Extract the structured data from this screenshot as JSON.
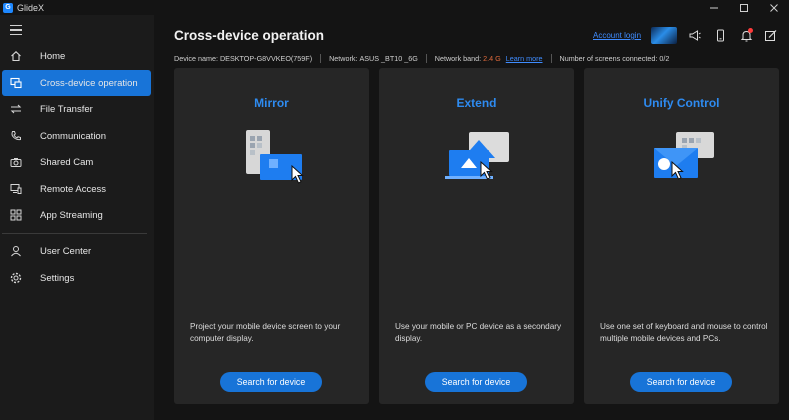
{
  "app": {
    "name": "GlideX",
    "logo_letter": "G"
  },
  "window_controls": [
    "minimize",
    "maximize",
    "close"
  ],
  "sidebar": {
    "items": [
      {
        "label": "Home",
        "icon": "home-icon",
        "active": false
      },
      {
        "label": "Cross-device operation",
        "icon": "cross-device-icon",
        "active": true
      },
      {
        "label": "File Transfer",
        "icon": "transfer-icon",
        "active": false
      },
      {
        "label": "Communication",
        "icon": "phone-icon",
        "active": false
      },
      {
        "label": "Shared Cam",
        "icon": "camera-icon",
        "active": false
      },
      {
        "label": "Remote Access",
        "icon": "remote-icon",
        "active": false
      },
      {
        "label": "App Streaming",
        "icon": "grid-icon",
        "active": false
      },
      {
        "label": "User Center",
        "icon": "user-icon",
        "active": false
      },
      {
        "label": "Settings",
        "icon": "gear-icon",
        "active": false
      }
    ]
  },
  "header": {
    "title": "Cross-device operation",
    "account_login": "Account login",
    "icons": [
      "megaphone-icon",
      "phone-device-icon",
      "bell-icon",
      "edit-note-icon"
    ]
  },
  "info_bar": {
    "device_name_label": "Device name:",
    "device_name_value": "DESKTOP-G8VVKEO(759F)",
    "network_label": "Network:",
    "network_value": "ASUS _BT10 _6G",
    "band_label": "Network band:",
    "band_value": "2.4 G",
    "learn_more": "Learn more",
    "screens_label": "Number of screens connected:",
    "screens_value": "0/2"
  },
  "cards": [
    {
      "title": "Mirror",
      "description": "Project your mobile device screen to your computer display.",
      "button": "Search for device",
      "art": "mirror-illustration"
    },
    {
      "title": "Extend",
      "description": "Use your mobile or PC device as a secondary display.",
      "button": "Search for device",
      "art": "extend-illustration"
    },
    {
      "title": "Unify Control",
      "description": "Use one set of keyboard and mouse to control multiple mobile devices and PCs.",
      "button": "Search for device",
      "art": "unify-control-illustration"
    }
  ],
  "colors": {
    "accent": "#1874d8",
    "title_blue": "#2e8bf0",
    "link": "#3f8cff",
    "band_highlight": "#e06a3c",
    "notification": "#ff3b3b"
  }
}
